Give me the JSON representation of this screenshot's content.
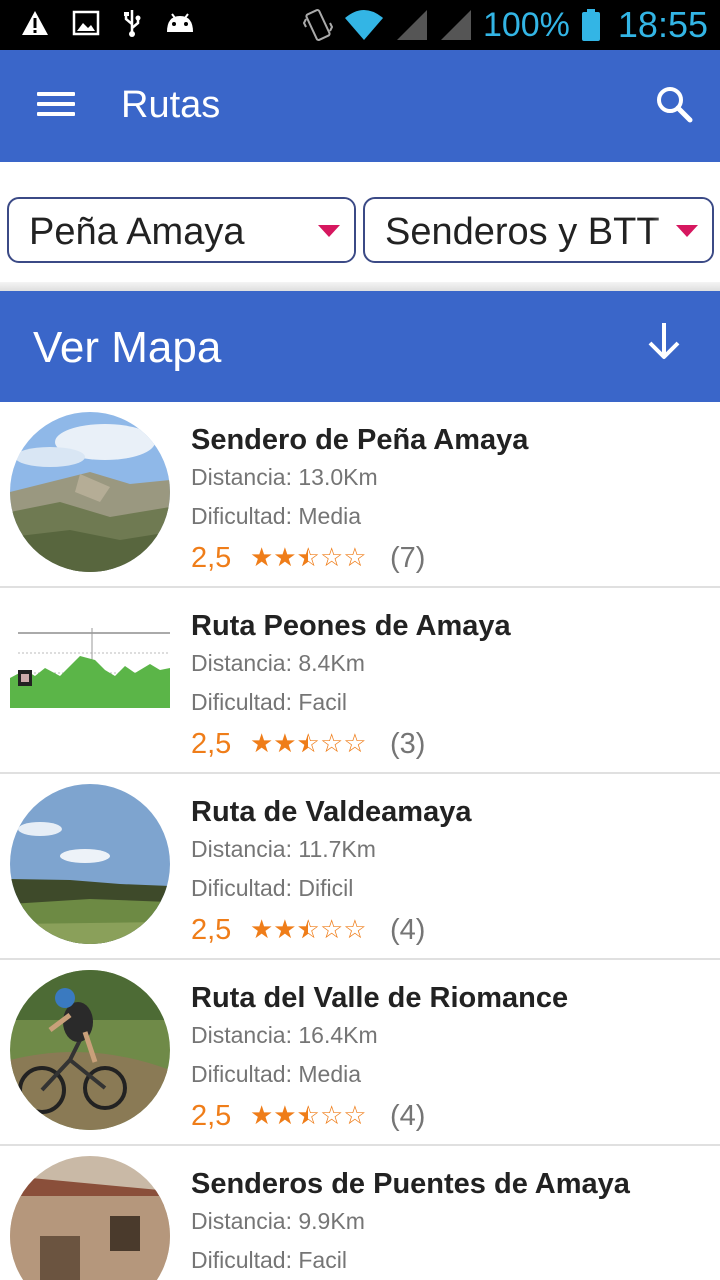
{
  "status_bar": {
    "battery": "100%",
    "time": "18:55",
    "icons": [
      "warning-icon",
      "image-icon",
      "usb-icon",
      "android-icon",
      "vibrate-icon",
      "wifi-icon",
      "signal-icon",
      "signal-icon",
      "battery-icon"
    ]
  },
  "app_bar": {
    "title": "Rutas",
    "color": "#3a66c9"
  },
  "filters": {
    "zone": "Peña Amaya",
    "type": "Senderos y BTT"
  },
  "map_bar": {
    "label": "Ver Mapa"
  },
  "routes": [
    {
      "title": "Sendero de Peña Amaya",
      "distance": "Distancia: 13.0Km",
      "difficulty": "Dificultad: Media",
      "score": "2,5",
      "rating": 2.5,
      "count": "(7)",
      "image": "mountain-landscape"
    },
    {
      "title": "Ruta Peones de Amaya",
      "distance": "Distancia: 8.4Km",
      "difficulty": "Dificultad: Facil",
      "score": "2,5",
      "rating": 2.5,
      "count": "(3)",
      "image": "elevation-profile"
    },
    {
      "title": "Ruta de Valdeamaya",
      "distance": "Distancia: 11.7Km",
      "difficulty": "Dificultad: Dificil",
      "score": "2,5",
      "rating": 2.5,
      "count": "(4)",
      "image": "valley-landscape"
    },
    {
      "title": "Ruta del Valle de Riomance",
      "distance": "Distancia: 16.4Km",
      "difficulty": "Dificultad: Media",
      "score": "2,5",
      "rating": 2.5,
      "count": "(4)",
      "image": "mountain-biker"
    },
    {
      "title": "Senderos de Puentes de Amaya",
      "distance": "Distancia: 9.9Km",
      "difficulty": "Dificultad: Facil",
      "score": "",
      "rating": null,
      "count": "",
      "image": "stone-village"
    }
  ]
}
